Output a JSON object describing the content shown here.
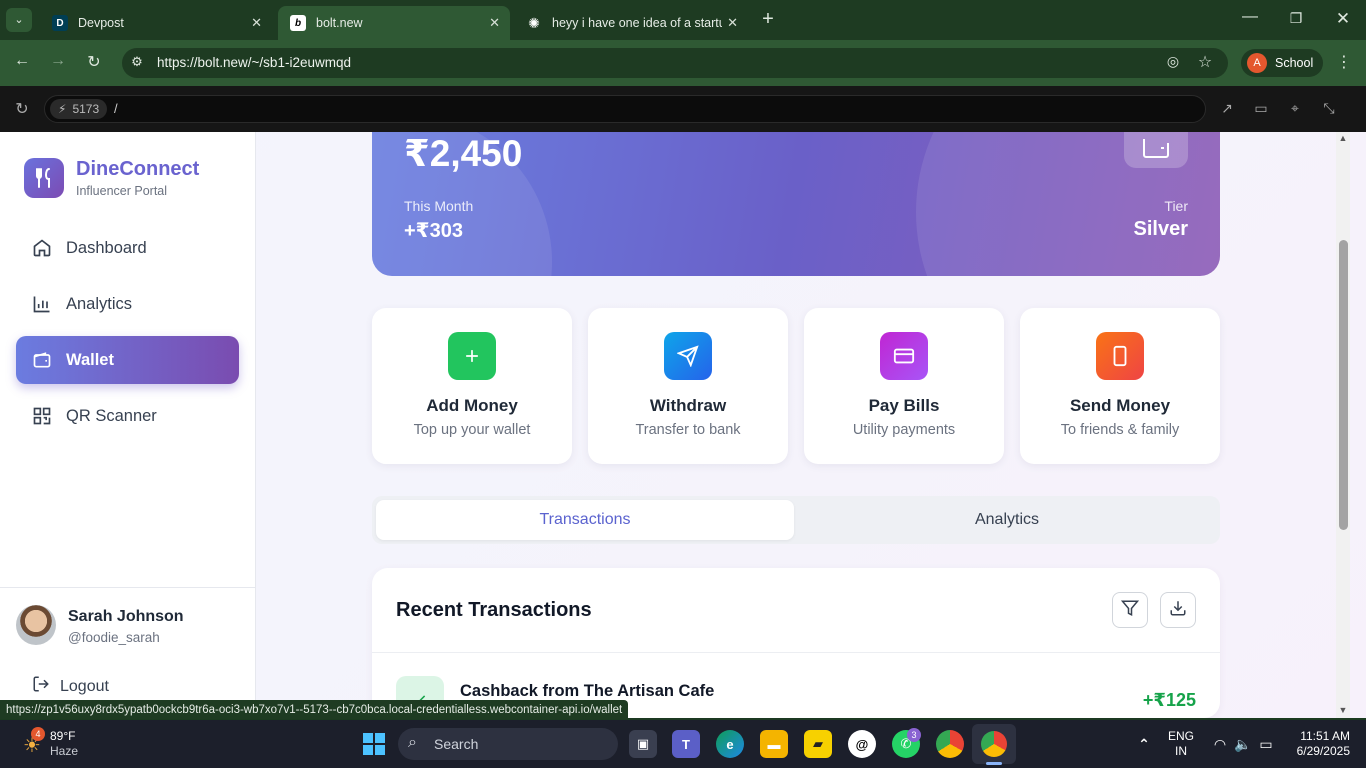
{
  "browser": {
    "tabs": [
      {
        "title": "Devpost",
        "favicon": "D"
      },
      {
        "title": "bolt.new",
        "favicon": "b"
      },
      {
        "title": "heyy i have one idea of a startu",
        "favicon": "✺"
      }
    ],
    "url": "https://bolt.new/~/sb1-i2euwmqd",
    "profile_letter": "A",
    "profile_label": "School",
    "dev_port": "5173",
    "dev_path": "/",
    "status_url": "https://zp1v56uxy8rdx5ypatb0ockcb9tr6a-oci3-wb7xo7v1--5173--cb7c0bca.local-credentialless.webcontainer-api.io/wallet"
  },
  "sidebar": {
    "brand": "DineConnect",
    "subtitle": "Influencer Portal",
    "items": [
      {
        "label": "Dashboard",
        "icon": "home-icon"
      },
      {
        "label": "Analytics",
        "icon": "bar-chart-icon"
      },
      {
        "label": "Wallet",
        "icon": "wallet-icon"
      },
      {
        "label": "QR Scanner",
        "icon": "qr-icon"
      }
    ],
    "user": {
      "name": "Sarah Johnson",
      "handle": "@foodie_sarah"
    },
    "logout": "Logout"
  },
  "wallet": {
    "balance": "₹2,450",
    "month_label": "This Month",
    "month_value": "+₹303",
    "tier_label": "Tier",
    "tier_value": "Silver"
  },
  "actions": [
    {
      "title": "Add Money",
      "subtitle": "Top up your wallet",
      "color": "#22c55e"
    },
    {
      "title": "Withdraw",
      "subtitle": "Transfer to bank",
      "color": "#0ea5e9"
    },
    {
      "title": "Pay Bills",
      "subtitle": "Utility payments",
      "color": "#c026d3"
    },
    {
      "title": "Send Money",
      "subtitle": "To friends & family",
      "color": "#f97316"
    }
  ],
  "tabs": {
    "transactions": "Transactions",
    "analytics": "Analytics"
  },
  "recent": {
    "title": "Recent Transactions",
    "items": [
      {
        "name": "Cashback from The Artisan Cafe",
        "amount": "+₹125"
      }
    ]
  },
  "taskbar": {
    "weather_temp": "89°F",
    "weather_desc": "Haze",
    "weather_badge": "4",
    "search": "Search",
    "whatsapp_badge": "3",
    "lang_line1": "ENG",
    "lang_line2": "IN",
    "time": "11:51 AM",
    "date": "6/29/2025"
  }
}
